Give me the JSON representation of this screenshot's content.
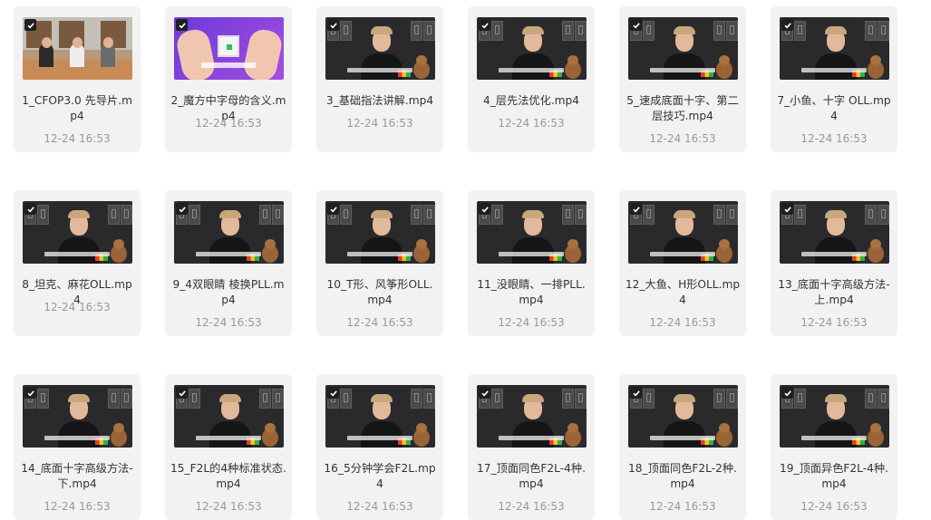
{
  "files": [
    {
      "name": "1_CFOP3.0 先导片.mp4",
      "date": "12-24 16:53",
      "thumb": "classroom",
      "checked": true
    },
    {
      "name": "2_魔方中字母的含义.mp4",
      "date": "12-24 16:53",
      "thumb": "hands",
      "checked": true
    },
    {
      "name": "3_基础指法讲解.mp4",
      "date": "12-24 16:53",
      "thumb": "host",
      "checked": true
    },
    {
      "name": "4_层先法优化.mp4",
      "date": "12-24 16:53",
      "thumb": "host",
      "checked": true
    },
    {
      "name": "5_速成底面十字、第二层技巧.mp4",
      "date": "12-24 16:53",
      "thumb": "host",
      "checked": true
    },
    {
      "name": "7_小鱼、十字 OLL.mp4",
      "date": "12-24 16:53",
      "thumb": "host",
      "checked": true
    },
    {
      "name": "8_坦克、麻花OLL.mp4",
      "date": "12-24 16:53",
      "thumb": "host",
      "checked": true
    },
    {
      "name": "9_4双眼睛 棱换PLL.mp4",
      "date": "12-24 16:53",
      "thumb": "host",
      "checked": true
    },
    {
      "name": "10_T形、风筝形OLL.mp4",
      "date": "12-24 16:53",
      "thumb": "host",
      "checked": true
    },
    {
      "name": "11_没眼睛、一排PLL.mp4",
      "date": "12-24 16:53",
      "thumb": "host",
      "checked": true
    },
    {
      "name": "12_大鱼、H形OLL.mp4",
      "date": "12-24 16:53",
      "thumb": "host",
      "checked": true
    },
    {
      "name": "13_底面十字高级方法-上.mp4",
      "date": "12-24 16:53",
      "thumb": "host",
      "checked": true
    },
    {
      "name": "14_底面十字高级方法-下.mp4",
      "date": "12-24 16:53",
      "thumb": "host",
      "checked": true
    },
    {
      "name": "15_F2L的4种标准状态.mp4",
      "date": "12-24 16:53",
      "thumb": "host",
      "checked": true
    },
    {
      "name": "16_5分钟学会F2L.mp4",
      "date": "12-24 16:53",
      "thumb": "host",
      "checked": true
    },
    {
      "name": "17_顶面同色F2L-4种.mp4",
      "date": "12-24 16:53",
      "thumb": "host",
      "checked": true
    },
    {
      "name": "18_顶面同色F2L-2种.mp4",
      "date": "12-24 16:53",
      "thumb": "host",
      "checked": true
    },
    {
      "name": "19_顶面异色F2L-4种.mp4",
      "date": "12-24 16:53",
      "thumb": "host",
      "checked": true
    }
  ],
  "colors": {
    "card_bg": "#f2f2f3",
    "name": "#333333",
    "date": "#999999",
    "checkbox": "#1f1f1f"
  },
  "icons": {
    "checkbox": "checkmark-icon"
  }
}
